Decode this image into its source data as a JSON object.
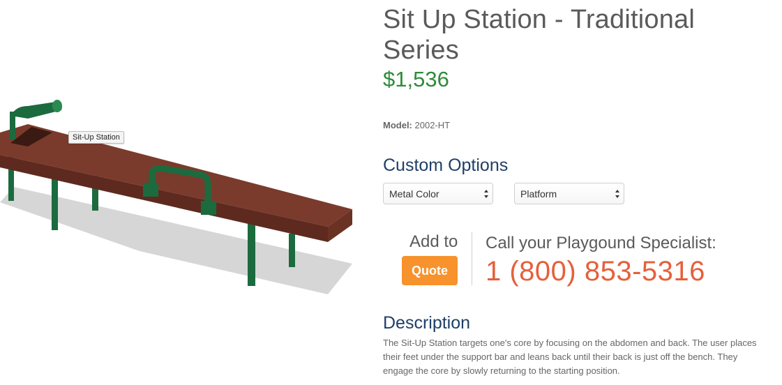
{
  "product": {
    "title": "Sit Up Station - Traditional Series",
    "price": "$1,536",
    "model_label": "Model:",
    "model_value": "2002-HT",
    "image_tooltip": "Sit-Up Station",
    "colors": {
      "price": "#2e8b3a",
      "heading": "#1f3f66",
      "phone": "#e5603b",
      "quote_button": "#f7922c",
      "bench_wood": "#7a3b2c",
      "frame_green": "#155a34"
    }
  },
  "options": {
    "heading": "Custom Options",
    "selects": [
      {
        "label": "Metal Color"
      },
      {
        "label": "Platform"
      }
    ]
  },
  "quote": {
    "add_to": "Add to",
    "button_label": "Quote",
    "call_label": "Call your Playgound Specialist:",
    "phone": "1 (800) 853-5316"
  },
  "description": {
    "heading": "Description",
    "text": "The Sit-Up Station targets one's core by focusing on the abdomen and back. The user places their feet under the support bar and leans back until their back is just off the bench. They engage the core by slowly returning to the starting position."
  }
}
